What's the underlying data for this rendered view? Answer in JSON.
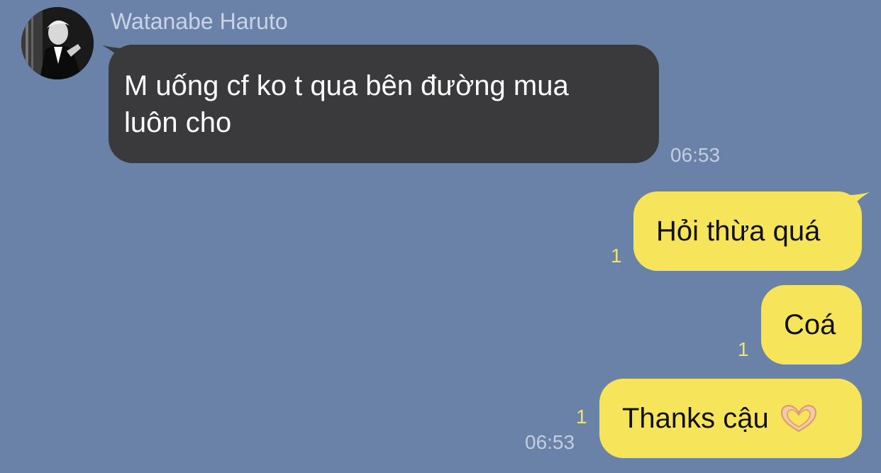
{
  "chat": {
    "sender_name": "Watanabe Haruto",
    "colors": {
      "background": "#6b82a8",
      "incoming_bubble": "#3a3a3c",
      "outgoing_bubble": "#f6e55a",
      "unread_count": "#f3e26a"
    },
    "incoming": [
      {
        "line1": "M uống cf ko t qua bên đường mua",
        "line2": "luôn cho",
        "time": "06:53"
      }
    ],
    "outgoing": [
      {
        "text": "Hỏi thừa quá",
        "unread": "1"
      },
      {
        "text": "Coá",
        "unread": "1"
      },
      {
        "text": "Thanks cậu",
        "emoji": "heart-hands-emoji",
        "unread": "1",
        "time": "06:53"
      }
    ]
  }
}
